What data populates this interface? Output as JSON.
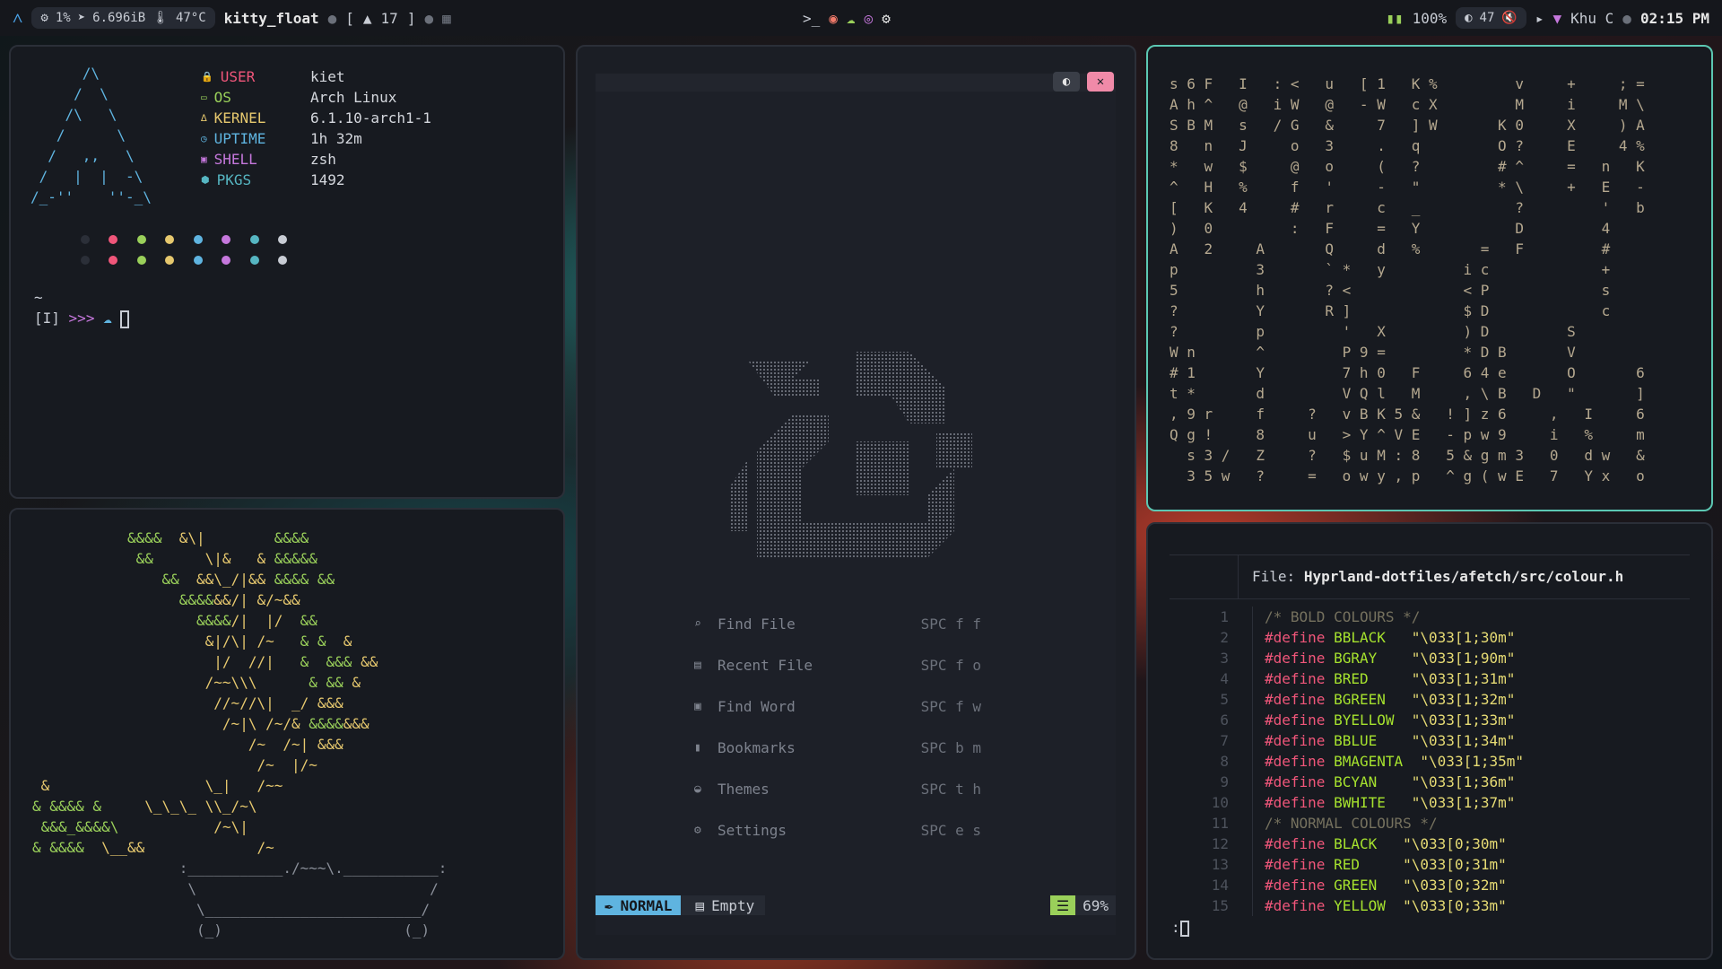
{
  "topbar": {
    "cpu": "1%",
    "mem": "6.696iB",
    "temp": "47°C",
    "window_title": "kitty_float",
    "workspace_open": "[",
    "workspace_num": "17",
    "workspace_close": "]",
    "battery": "100%",
    "brightness": "47",
    "network": "Khu C",
    "clock": "02:15 PM"
  },
  "fetch": {
    "info": [
      {
        "key": "USER",
        "value": "kiet",
        "color": "#f0567a"
      },
      {
        "key": "OS",
        "value": "Arch Linux",
        "color": "#9ad05a"
      },
      {
        "key": "KERNEL",
        "value": "6.1.10-arch1-1",
        "color": "#e6c86e"
      },
      {
        "key": "UPTIME",
        "value": "1h 32m",
        "color": "#5fb4e0"
      },
      {
        "key": "SHELL",
        "value": "zsh",
        "color": "#c678dd"
      },
      {
        "key": "PKGS",
        "value": "1492",
        "color": "#56b6c2"
      }
    ],
    "palette": [
      "#2b2f38",
      "#f0567a",
      "#9ad05a",
      "#e6c86e",
      "#5fb4e0",
      "#c678dd",
      "#56b6c2",
      "#c8ccd4"
    ],
    "prompt_dir": "~",
    "prompt_mode": "[I]",
    "prompt_arrows": ">>>"
  },
  "nvim": {
    "dashboard": [
      {
        "icon": "search-icon",
        "label": "Find File",
        "keys": "SPC f f"
      },
      {
        "icon": "file-icon",
        "label": "Recent File",
        "keys": "SPC f o"
      },
      {
        "icon": "text-icon",
        "label": "Find Word",
        "keys": "SPC f w"
      },
      {
        "icon": "bookmark-icon",
        "label": "Bookmarks",
        "keys": "SPC b m"
      },
      {
        "icon": "palette-icon",
        "label": "Themes",
        "keys": "SPC t h"
      },
      {
        "icon": "gear-icon",
        "label": "Settings",
        "keys": "SPC e s"
      }
    ],
    "mode": "NORMAL",
    "buffer": "Empty",
    "percent": "69%"
  },
  "code": {
    "file_label": "File:",
    "file_path": "Hyprland-dotfiles/afetch/src/colour.h",
    "lines": [
      {
        "n": "1",
        "kind": "comment",
        "text": "/* BOLD COLOURS */"
      },
      {
        "n": "2",
        "kind": "define",
        "name": "BBLACK ",
        "value": "\"\\033[1;30m\""
      },
      {
        "n": "3",
        "kind": "define",
        "name": "BGRAY  ",
        "value": "\"\\033[1;90m\""
      },
      {
        "n": "4",
        "kind": "define",
        "name": "BRED   ",
        "value": "\"\\033[1;31m\""
      },
      {
        "n": "5",
        "kind": "define",
        "name": "BGREEN ",
        "value": "\"\\033[1;32m\""
      },
      {
        "n": "6",
        "kind": "define",
        "name": "BYELLOW",
        "value": "\"\\033[1;33m\""
      },
      {
        "n": "7",
        "kind": "define",
        "name": "BBLUE  ",
        "value": "\"\\033[1;34m\""
      },
      {
        "n": "8",
        "kind": "define",
        "name": "BMAGENTA",
        "value": "\"\\033[1;35m\""
      },
      {
        "n": "9",
        "kind": "define",
        "name": "BCYAN  ",
        "value": "\"\\033[1;36m\""
      },
      {
        "n": "10",
        "kind": "define",
        "name": "BWHITE ",
        "value": "\"\\033[1;37m\""
      },
      {
        "n": "11",
        "kind": "comment",
        "text": "/* NORMAL COLOURS */"
      },
      {
        "n": "12",
        "kind": "define",
        "name": "BLACK ",
        "value": "\"\\033[0;30m\""
      },
      {
        "n": "13",
        "kind": "define",
        "name": "RED   ",
        "value": "\"\\033[0;31m\""
      },
      {
        "n": "14",
        "kind": "define",
        "name": "GREEN ",
        "value": "\"\\033[0;32m\""
      },
      {
        "n": "15",
        "kind": "define",
        "name": "YELLOW",
        "value": "\"\\033[0;33m\""
      }
    ],
    "define_kw": "#define",
    "cmdline": ":"
  },
  "matrix": {
    "rows": [
      "s 6 F   I   : <   u   [ 1   K %         v     +     ; =",
      "A h ^   @   i W   @   - W   c X         M     i     M \\",
      "S B M   s   / G   &     7   ] W       K 0     X     ) A",
      "8   n   J     o   3     .   q         O ?     E     4 %",
      "*   w   $     @   o     (   ?         # ^     =   n   K",
      "^   H   %     f   '     -   \"         * \\     +   E   -",
      "[   K   4     #   r     c   _           ?         '   b",
      ")   0         :   F     =   Y           D         4",
      "A   2     A       Q     d   %       =   F         #",
      "p         3       ` *   y         i c             +",
      "5         h       ? <             < P             s",
      "?         Y       R ]             $ D             c",
      "?         p         '   X         ) D         S",
      "W n       ^         P 9 =         * D B       V",
      "# 1       Y         7 h 0   F     6 4 e       O       6",
      "t *       d         V Q l   M     , \\ B   D   \"       ]",
      ", 9 r     f     ?   v B K 5 &   ! ] z 6     ,   I     6",
      "Q g !     8     u   > Y ^ V E   - p w 9     i   %     m",
      "  s 3 /   Z     ?   $ u M : 8   5 & g m 3   0   d w   &",
      "  3 5 w   ?     =   o w y , p   ^ g ( w E   7   Y x   o"
    ]
  }
}
